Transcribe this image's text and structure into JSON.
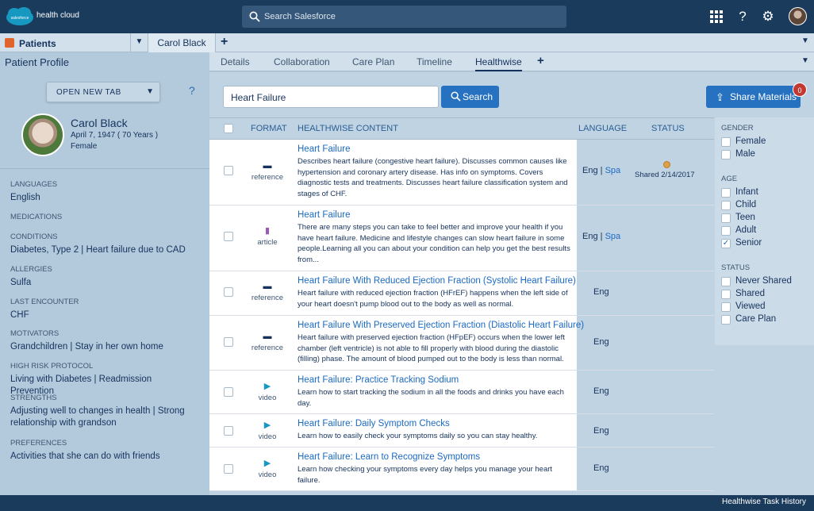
{
  "header": {
    "logo_text": "salesforce",
    "brand": "health cloud",
    "search_placeholder": "Search Salesforce",
    "icons": [
      "apps-grid-icon",
      "help-icon",
      "settings-gear-icon",
      "user-avatar"
    ]
  },
  "workspace_tabs": {
    "patients_label": "Patients",
    "carol_label": "Carol Black"
  },
  "profile": {
    "title": "Patient Profile",
    "open_new_tab": "OPEN NEW TAB",
    "help": "?",
    "name": "Carol Black",
    "dob": "April 7, 1947 ( 70 Years )",
    "gender": "Female",
    "fields": [
      {
        "label": "LANGUAGES",
        "value": "English"
      },
      {
        "label": "MEDICATIONS",
        "value": ""
      },
      {
        "label": "CONDITIONS",
        "value": "Diabetes, Type 2 | Heart failure due to CAD"
      },
      {
        "label": "ALLERGIES",
        "value": "Sulfa"
      },
      {
        "label": "LAST ENCOUNTER",
        "value": "CHF"
      },
      {
        "label": "MOTIVATORS",
        "value": "Grandchildren | Stay in her own home"
      },
      {
        "label": "HIGH RISK PROTOCOL",
        "value": "Living with Diabetes | Readmission Prevention"
      },
      {
        "label": "STRENGTHS",
        "value": "Adjusting well to changes in health | Strong relationship with grandson"
      },
      {
        "label": "PREFERENCES",
        "value": "Activities that she can do with friends"
      }
    ]
  },
  "subtabs": [
    "Details",
    "Collaboration",
    "Care Plan",
    "Timeline",
    "Healthwise"
  ],
  "search": {
    "keyword": "Heart Failure",
    "button": "Search",
    "share_button": "Share Materials",
    "share_badge": "0"
  },
  "table": {
    "headers": {
      "format": "FORMAT",
      "content": "HEALTHWISE CONTENT",
      "language": "LANGUAGE",
      "status": "STATUS"
    },
    "rows": [
      {
        "format": "reference",
        "format_icon": "folder-icon",
        "title": "Heart Failure",
        "desc": "Describes heart failure (congestive heart failure). Discusses common causes like hypertension and coronary artery disease. Has info on symptoms. Covers diagnostic tests and treatments. Discusses heart failure classification system and stages of CHF.",
        "lang_en": "Eng",
        "lang_sep": " | ",
        "lang_es": "Spa",
        "status": "Shared 2/14/2017"
      },
      {
        "format": "article",
        "format_icon": "document-icon",
        "title": "Heart Failure",
        "desc": "There are many steps you can take to feel better and improve your health if you have heart failure. Medicine and lifestyle changes can slow heart failure in some people.Learning all you can about your condition can help you get the best results from...",
        "lang_en": "Eng",
        "lang_sep": " | ",
        "lang_es": "Spa",
        "status": ""
      },
      {
        "format": "reference",
        "format_icon": "folder-icon",
        "title": "Heart Failure With Reduced Ejection Fraction (Systolic Heart Failure)",
        "desc": "Heart failure with reduced ejection fraction (HFrEF) happens when the left side of your heart doesn't pump blood out to the body as well as normal.",
        "lang_en": "Eng",
        "lang_sep": "",
        "lang_es": "",
        "status": ""
      },
      {
        "format": "reference",
        "format_icon": "folder-icon",
        "title": "Heart Failure With Preserved Ejection Fraction (Diastolic Heart Failure)",
        "desc": "Heart failure with preserved ejection fraction (HFpEF) occurs when the lower left chamber (left ventricle) is not able to fill properly with blood during the diastolic (filling) phase. The amount of blood pumped out to the body is less than normal.",
        "lang_en": "Eng",
        "lang_sep": "",
        "lang_es": "",
        "status": ""
      },
      {
        "format": "video",
        "format_icon": "play-icon",
        "title": "Heart Failure: Practice Tracking Sodium",
        "desc": "Learn how to start tracking the sodium in all the foods and drinks you have each day.",
        "lang_en": "Eng",
        "lang_sep": "",
        "lang_es": "",
        "status": ""
      },
      {
        "format": "video",
        "format_icon": "play-icon",
        "title": "Heart Failure: Daily Symptom Checks",
        "desc": "Learn how to easily check your symptoms daily so you can stay healthy.",
        "lang_en": "Eng",
        "lang_sep": "",
        "lang_es": "",
        "status": ""
      },
      {
        "format": "video",
        "format_icon": "play-icon",
        "title": "Heart Failure: Learn to Recognize Symptoms",
        "desc": "Learn how checking your symptoms every day helps you manage your heart failure.",
        "lang_en": "Eng",
        "lang_sep": "",
        "lang_es": "",
        "status": ""
      }
    ]
  },
  "filters": {
    "gender": {
      "label": "GENDER",
      "options": [
        "Female",
        "Male"
      ]
    },
    "age": {
      "label": "AGE",
      "options": [
        "Infant",
        "Child",
        "Teen",
        "Adult",
        "Senior"
      ],
      "checked": "Senior"
    },
    "status": {
      "label": "STATUS",
      "options": [
        "Never Shared",
        "Shared",
        "Viewed",
        "Care Plan"
      ]
    }
  },
  "footer": {
    "label": "Healthwise Task History"
  },
  "colors": {
    "header_bg": "#1b3b5c",
    "accent": "#2671c0",
    "badge": "#c23934",
    "link": "#1c6ac2"
  }
}
